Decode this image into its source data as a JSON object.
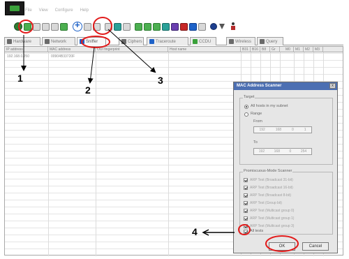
{
  "window": {
    "menus": [
      "File",
      "View",
      "Configure",
      "Help"
    ]
  },
  "tabs": [
    {
      "label": "Hardware",
      "icon": "list-icon"
    },
    {
      "label": "Network",
      "icon": "network-icon"
    },
    {
      "label": "Sniffer",
      "icon": "sniffer-icon"
    },
    {
      "label": "Ciphers",
      "icon": "key-icon"
    },
    {
      "label": "Traceroute",
      "icon": "route-icon"
    },
    {
      "label": "CCDU",
      "icon": "ccdu-icon"
    },
    {
      "label": "Wireless",
      "icon": "wireless-icon"
    },
    {
      "label": "Query",
      "icon": "query-icon"
    }
  ],
  "table": {
    "columns": [
      "IP address",
      "MAC address",
      "OUI fingerprint",
      "Host name",
      "B31",
      "B16",
      "B8",
      "Gr",
      "M0",
      "M1",
      "M2",
      "M3"
    ],
    "rows": [
      [
        "192.168.0.250",
        "00904B33720F",
        "",
        "",
        "",
        "",
        "",
        "",
        "",
        "",
        "",
        ""
      ]
    ]
  },
  "dialog": {
    "title": "MAC Address Scanner",
    "close": "x",
    "target_label": "Target",
    "opt_all_hosts": "All hosts in my subnet",
    "opt_range": "Range",
    "from_label": "From",
    "to_label": "To",
    "from_ip": [
      "192",
      "168",
      "0",
      "1"
    ],
    "to_ip": [
      "192",
      "168",
      "0",
      "254"
    ],
    "promisc_label": "Promiscuous-Mode Scanner",
    "checks": [
      "ARP Test (Broadcast 31-bit)",
      "ARP Test (Broadcast 16-bit)",
      "ARP Test (Broadcast 8-bit)",
      "ARP Test (Group bit)",
      "ARP Test (Multicast group 0)",
      "ARP Test (Multicast group 1)",
      "ARP Test (Multicast group 3)"
    ],
    "all_tests": "All tests",
    "ok": "OK",
    "cancel": "Cancel"
  },
  "annotations": {
    "n1": "1",
    "n2": "2",
    "n3": "3",
    "n4": "4",
    "color": "#e21b1b"
  }
}
